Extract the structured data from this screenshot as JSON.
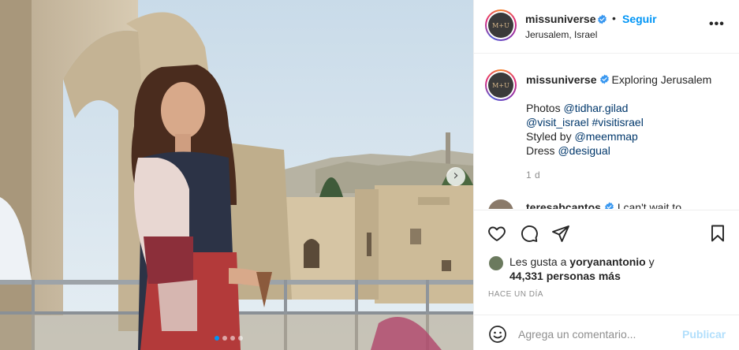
{
  "post": {
    "username": "missuniverse",
    "avatar_text": "M+U",
    "location": "Jerusalem, Israel",
    "separator": "•",
    "follow_label": "Seguir",
    "more_label": "•••",
    "photo_count": 4,
    "active_photo": 1
  },
  "caption": {
    "username": "missuniverse",
    "text": "Exploring Jerusalem",
    "photos_label": "Photos",
    "photos_handle": "@tidhar.gilad",
    "visit_handle": "@visit_israel",
    "hashtag": "#visitisrael",
    "styled_label": "Styled by",
    "styled_handle": "@meemmap",
    "dress_label": "Dress",
    "dress_handle": "@desigual",
    "time": "1 d"
  },
  "next_comment": {
    "username": "teresabcantos",
    "text": "I can't wait to"
  },
  "likes": {
    "prefix": "Les gusta a",
    "user": "yoryanantonio",
    "conj": "y",
    "others": "44,331 personas más"
  },
  "timestamp": "HACE UN DÍA",
  "comment_box": {
    "placeholder": "Agrega un comentario...",
    "post_label": "Publicar"
  },
  "colors": {
    "accent": "#0095f6",
    "link": "#00376b",
    "muted": "#8e8e8e",
    "post_disabled": "#b2dffc"
  },
  "icons": {
    "verified": "verified-badge-icon",
    "like": "heart-icon",
    "comment": "comment-bubble-icon",
    "share": "paper-plane-icon",
    "save": "bookmark-icon",
    "emoji": "smiley-icon",
    "next": "chevron-right-icon"
  }
}
